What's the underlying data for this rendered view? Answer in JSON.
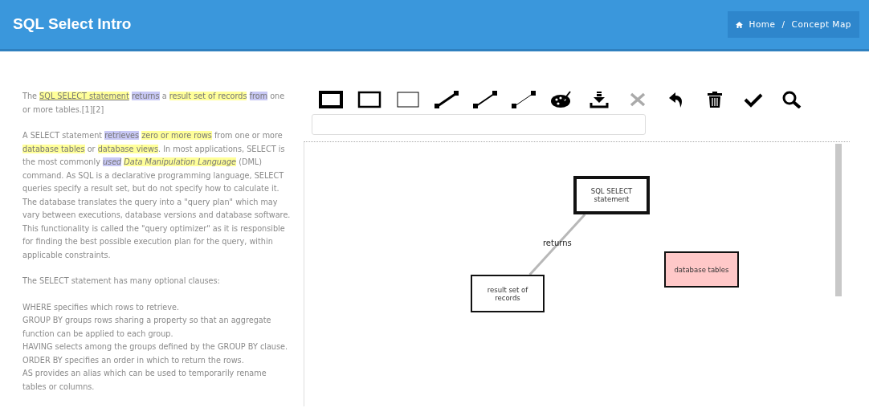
{
  "header": {
    "title": "SQL Select Intro",
    "breadcrumb": [
      "Home",
      "Concept Map"
    ],
    "separator": "/"
  },
  "text": {
    "paragraphs": [
      {
        "segments": [
          {
            "text": "The "
          },
          {
            "text": "SQL SELECT statement",
            "kind": "concept",
            "underline": true
          },
          {
            "text": "returns",
            "kind": "relation"
          },
          {
            "text": " a "
          },
          {
            "text": "result set of records",
            "kind": "concept"
          },
          {
            "text": "from",
            "kind": "relation"
          },
          {
            "text": " one or more tables.[1][2]"
          }
        ]
      },
      {
        "segments": [
          {
            "text": "A SELECT statement "
          },
          {
            "text": "retrieves",
            "kind": "relation"
          },
          {
            "text": "zero or more rows",
            "kind": "concept"
          },
          {
            "text": " from one or more "
          },
          {
            "text": "database tables",
            "kind": "concept"
          },
          {
            "text": " or "
          },
          {
            "text": "database views",
            "kind": "concept"
          },
          {
            "text": ". In most applications, SELECT is the most commonly "
          },
          {
            "text": "used",
            "kind": "relation",
            "italic": true
          },
          {
            "text": "Data Manipulation Language",
            "kind": "concept",
            "italic": true
          },
          {
            "text": " (DML) command. As SQL is a declarative programming language, SELECT queries specify a result set, but do not specify how to calculate it. The database translates the query into a \"query plan\" which may vary between executions, database versions and database software. This functionality is called the \"query optimizer\" as it is responsible for finding the best possible execution plan for the query, within applicable constraints."
          }
        ]
      },
      {
        "segments": [
          {
            "text": "The SELECT statement has many optional clauses:"
          }
        ]
      }
    ],
    "clauses": [
      "WHERE specifies which rows to retrieve.",
      "GROUP BY groups rows sharing a property so that an aggregate function can be applied to each group.",
      "HAVING selects among the groups defined by the GROUP BY clause.",
      "ORDER BY specifies an order in which to return the rows.",
      "AS provides an alias which can be used to temporarily rename tables or columns."
    ]
  },
  "toolbar": [
    {
      "kind": "border-thick",
      "disabled": false
    },
    {
      "kind": "border-medium",
      "disabled": false
    },
    {
      "kind": "border-thin",
      "disabled": false
    },
    {
      "kind": "line-thick",
      "disabled": false
    },
    {
      "kind": "line-medium",
      "disabled": false
    },
    {
      "kind": "line-thin",
      "disabled": false
    },
    {
      "kind": "palette",
      "disabled": false
    },
    {
      "kind": "download",
      "disabled": false
    },
    {
      "kind": "close",
      "disabled": true
    },
    {
      "kind": "undo",
      "disabled": false
    },
    {
      "kind": "trash",
      "disabled": false
    },
    {
      "kind": "check",
      "disabled": false
    },
    {
      "kind": "search",
      "disabled": false
    }
  ],
  "concept_map": {
    "nodes": [
      {
        "label": "SQL SELECT statement",
        "kind": "bold",
        "selected": false
      },
      {
        "label": "result set of records",
        "kind": "plain",
        "selected": false
      },
      {
        "label": "database tables",
        "kind": "plain",
        "selected": true
      }
    ],
    "edges": [
      {
        "label": "returns"
      }
    ]
  }
}
